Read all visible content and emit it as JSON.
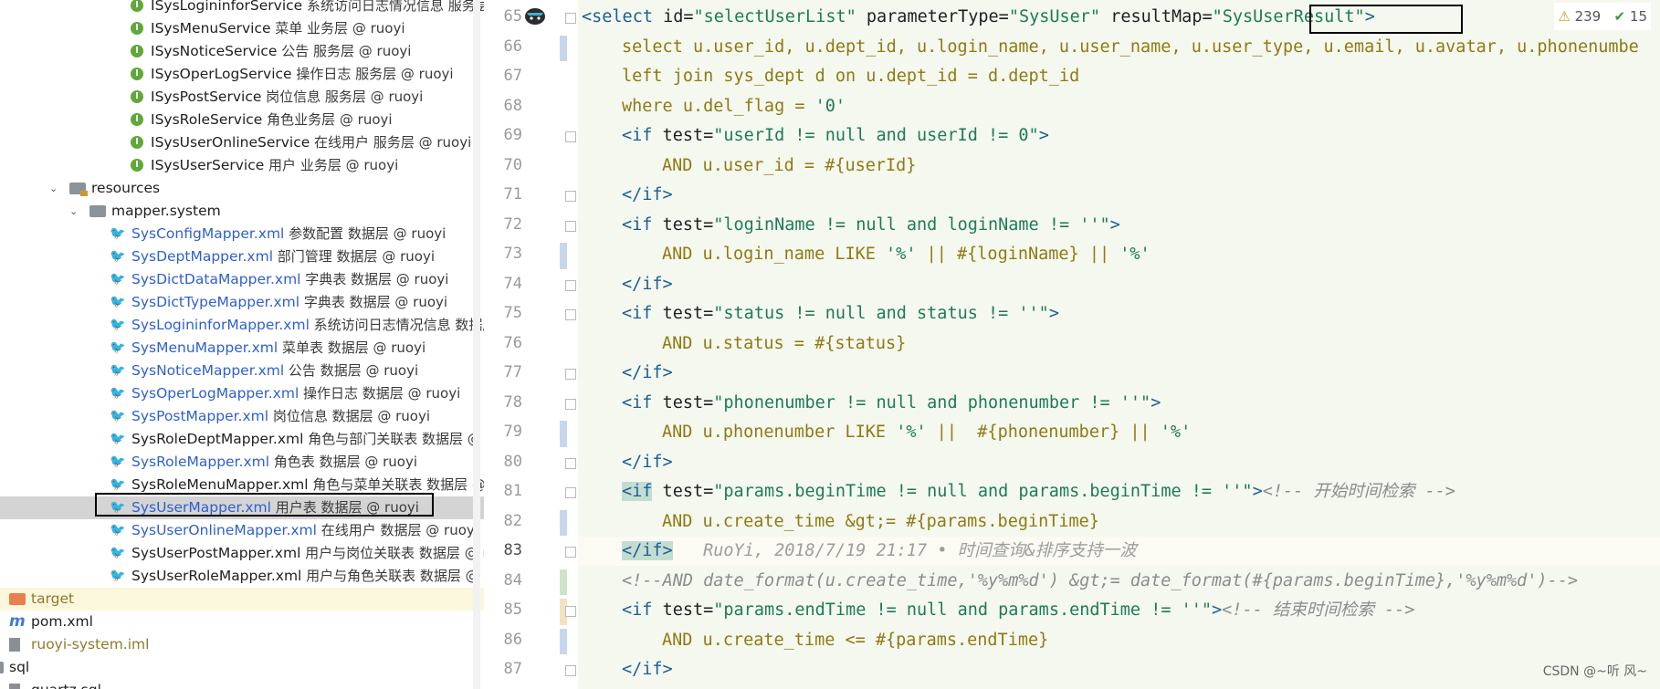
{
  "tree": {
    "items": [
      {
        "indent": 143,
        "icon": "interface",
        "name": "ISysLogininforService",
        "desc": "系统访问日志情况信息 服务层",
        "color": "dark"
      },
      {
        "indent": 143,
        "icon": "interface",
        "name": "ISysMenuService",
        "desc": "菜单 业务层 @ ruoyi",
        "color": "dark"
      },
      {
        "indent": 143,
        "icon": "interface",
        "name": "ISysNoticeService",
        "desc": "公告 服务层 @ ruoyi",
        "color": "dark"
      },
      {
        "indent": 143,
        "icon": "interface",
        "name": "ISysOperLogService",
        "desc": "操作日志 服务层 @ ruoyi",
        "color": "dark"
      },
      {
        "indent": 143,
        "icon": "interface",
        "name": "ISysPostService",
        "desc": "岗位信息 服务层 @ ruoyi",
        "color": "dark"
      },
      {
        "indent": 143,
        "icon": "interface",
        "name": "ISysRoleService",
        "desc": "角色业务层 @ ruoyi",
        "color": "dark"
      },
      {
        "indent": 143,
        "icon": "interface",
        "name": "ISysUserOnlineService",
        "desc": "在线用户 服务层 @ ruoyi",
        "color": "dark"
      },
      {
        "indent": 143,
        "icon": "interface",
        "name": "ISysUserService",
        "desc": "用户 业务层 @ ruoyi",
        "color": "dark"
      },
      {
        "indent": 76,
        "icon": "res-folder",
        "arrow": "⌄",
        "name": "resources",
        "desc": "",
        "color": "dark"
      },
      {
        "indent": 98,
        "icon": "folder",
        "arrow": "⌄",
        "name": "mapper.system",
        "desc": "",
        "color": "dark"
      },
      {
        "indent": 120,
        "icon": "xml",
        "name": "SysConfigMapper.xml",
        "desc": "参数配置 数据层 @ ruoyi",
        "color": "blue"
      },
      {
        "indent": 120,
        "icon": "xml",
        "name": "SysDeptMapper.xml",
        "desc": "部门管理 数据层 @ ruoyi",
        "color": "blue"
      },
      {
        "indent": 120,
        "icon": "xml",
        "name": "SysDictDataMapper.xml",
        "desc": "字典表 数据层 @ ruoyi",
        "color": "blue"
      },
      {
        "indent": 120,
        "icon": "xml",
        "name": "SysDictTypeMapper.xml",
        "desc": "字典表 数据层 @ ruoyi",
        "color": "blue"
      },
      {
        "indent": 120,
        "icon": "xml",
        "name": "SysLogininforMapper.xml",
        "desc": "系统访问日志情况信息 数据层",
        "color": "blue"
      },
      {
        "indent": 120,
        "icon": "xml",
        "name": "SysMenuMapper.xml",
        "desc": "菜单表 数据层 @ ruoyi",
        "color": "blue"
      },
      {
        "indent": 120,
        "icon": "xml",
        "name": "SysNoticeMapper.xml",
        "desc": "公告 数据层 @ ruoyi",
        "color": "blue"
      },
      {
        "indent": 120,
        "icon": "xml",
        "name": "SysOperLogMapper.xml",
        "desc": "操作日志 数据层 @ ruoyi",
        "color": "blue"
      },
      {
        "indent": 120,
        "icon": "xml",
        "name": "SysPostMapper.xml",
        "desc": "岗位信息 数据层 @ ruoyi",
        "color": "blue"
      },
      {
        "indent": 120,
        "icon": "xml",
        "name": "SysRoleDeptMapper.xml",
        "desc": "角色与部门关联表 数据层 @ ru",
        "color": "dark"
      },
      {
        "indent": 120,
        "icon": "xml",
        "name": "SysRoleMapper.xml",
        "desc": "角色表 数据层 @ ruoyi",
        "color": "blue"
      },
      {
        "indent": 120,
        "icon": "xml",
        "name": "SysRoleMenuMapper.xml",
        "desc": "角色与菜单关联表 数据层 @ r",
        "color": "dark"
      },
      {
        "indent": 120,
        "icon": "xml",
        "name": "SysUserMapper.xml",
        "desc": "用户表 数据层 @ ruoyi",
        "color": "blue",
        "selected": true
      },
      {
        "indent": 120,
        "icon": "xml",
        "name": "SysUserOnlineMapper.xml",
        "desc": "在线用户 数据层 @ ruoyi",
        "color": "blue"
      },
      {
        "indent": 120,
        "icon": "xml",
        "name": "SysUserPostMapper.xml",
        "desc": "用户与岗位关联表 数据层 @ ru",
        "color": "dark"
      },
      {
        "indent": 120,
        "icon": "xml",
        "name": "SysUserRoleMapper.xml",
        "desc": "用户与角色关联表 数据层 @ ru",
        "color": "dark"
      },
      {
        "indent": 10,
        "icon": "orange-folder",
        "arrow": "›",
        "name": "target",
        "desc": "",
        "color": "olive",
        "target": true
      },
      {
        "indent": 10,
        "icon": "maven",
        "name": "pom.xml",
        "desc": "",
        "color": "dark"
      },
      {
        "indent": 10,
        "icon": "file",
        "name": "ruoyi-system.iml",
        "desc": "",
        "color": "olive"
      },
      {
        "indent": -14,
        "icon": "folder",
        "name": "sql",
        "desc": "",
        "color": "dark"
      },
      {
        "indent": 10,
        "icon": "file",
        "name": "quartz.sql",
        "desc": "",
        "color": "dark"
      }
    ]
  },
  "inspection": {
    "warning_icon": "warning-triangle-icon",
    "warnings": "239",
    "check_icon": "checkmark-icon",
    "checks": "15"
  },
  "editor": {
    "current_line": 83,
    "lines": [
      {
        "n": 65,
        "indent": 1,
        "mark": "",
        "fold": true,
        "segs": [
          [
            "tag",
            "<select "
          ],
          [
            "an",
            "id="
          ],
          [
            "av",
            "\"selectUserList\""
          ],
          [
            "an",
            " parameterType="
          ],
          [
            "av",
            "\"SysUser\""
          ],
          [
            "an",
            " resultMap="
          ],
          [
            "av",
            "\"SysUserResult\""
          ],
          [
            "tag",
            ">"
          ]
        ]
      },
      {
        "n": 66,
        "indent": 2,
        "mark": "mod",
        "segs": [
          [
            "sql",
            "select u.user_id, u.dept_id, u.login_name, u.user_name, u.user_type, u.email, u.avatar, u.phonenumbe"
          ]
        ]
      },
      {
        "n": 67,
        "indent": 2,
        "mark": "",
        "segs": [
          [
            "sql",
            "left join sys_dept d on u.dept_id = d.dept_id"
          ]
        ]
      },
      {
        "n": 68,
        "indent": 2,
        "mark": "",
        "segs": [
          [
            "sql",
            "where u.del_flag = "
          ],
          [
            "str",
            "'0'"
          ]
        ]
      },
      {
        "n": 69,
        "indent": 2,
        "mark": "",
        "fold": true,
        "segs": [
          [
            "tag",
            "<if "
          ],
          [
            "an",
            "test="
          ],
          [
            "av",
            "\"userId != null and userId != 0\""
          ],
          [
            "tag",
            ">"
          ]
        ]
      },
      {
        "n": 70,
        "indent": 3,
        "mark": "",
        "segs": [
          [
            "sql",
            "AND u.user_id = #{userId}"
          ]
        ]
      },
      {
        "n": 71,
        "indent": 2,
        "mark": "",
        "fold": true,
        "segs": [
          [
            "tag",
            "</if>"
          ]
        ]
      },
      {
        "n": 72,
        "indent": 2,
        "mark": "",
        "fold": true,
        "segs": [
          [
            "tag",
            "<if "
          ],
          [
            "an",
            "test="
          ],
          [
            "av",
            "\"loginName != null and loginName != ''\""
          ],
          [
            "tag",
            ">"
          ]
        ]
      },
      {
        "n": 73,
        "indent": 3,
        "mark": "mod",
        "segs": [
          [
            "sql",
            "AND u.login_name LIKE "
          ],
          [
            "str",
            "'%'"
          ],
          [
            "sql",
            " || #{loginName} || "
          ],
          [
            "str",
            "'%'"
          ]
        ]
      },
      {
        "n": 74,
        "indent": 2,
        "mark": "",
        "fold": true,
        "segs": [
          [
            "tag",
            "</if>"
          ]
        ]
      },
      {
        "n": 75,
        "indent": 2,
        "mark": "",
        "fold": true,
        "segs": [
          [
            "tag",
            "<if "
          ],
          [
            "an",
            "test="
          ],
          [
            "av",
            "\"status != null and status != ''\""
          ],
          [
            "tag",
            ">"
          ]
        ]
      },
      {
        "n": 76,
        "indent": 3,
        "mark": "",
        "segs": [
          [
            "sql",
            "AND u.status = #{status}"
          ]
        ]
      },
      {
        "n": 77,
        "indent": 2,
        "mark": "",
        "fold": true,
        "segs": [
          [
            "tag",
            "</if>"
          ]
        ]
      },
      {
        "n": 78,
        "indent": 2,
        "mark": "",
        "fold": true,
        "segs": [
          [
            "tag",
            "<if "
          ],
          [
            "an",
            "test="
          ],
          [
            "av",
            "\"phonenumber != null and phonenumber != ''\""
          ],
          [
            "tag",
            ">"
          ]
        ]
      },
      {
        "n": 79,
        "indent": 3,
        "mark": "mod",
        "segs": [
          [
            "sql",
            "AND u.phonenumber LIKE "
          ],
          [
            "str",
            "'%'"
          ],
          [
            "sql",
            " ||  #{phonenumber} || "
          ],
          [
            "str",
            "'%'"
          ]
        ]
      },
      {
        "n": 80,
        "indent": 2,
        "mark": "",
        "fold": true,
        "segs": [
          [
            "tag",
            "</if>"
          ]
        ]
      },
      {
        "n": 81,
        "indent": 2,
        "mark": "",
        "fold": true,
        "segs": [
          [
            "hltag",
            "<if"
          ],
          [
            "an",
            " test="
          ],
          [
            "av",
            "\"params.beginTime != null and params.beginTime != ''\""
          ],
          [
            "tag",
            ">"
          ],
          [
            "cmt",
            "<!-- 开始时间检索 -->"
          ]
        ]
      },
      {
        "n": 82,
        "indent": 3,
        "mark": "mod",
        "segs": [
          [
            "sql",
            "AND u.create_time &gt;= #{params.beginTime}"
          ]
        ]
      },
      {
        "n": 83,
        "indent": 2,
        "mark": "",
        "fold": true,
        "segs": [
          [
            "hltag",
            "</if>"
          ],
          [
            "blame",
            "   RuoYi, 2018/7/19 21:17 • 时间查询&排序支持一波"
          ]
        ]
      },
      {
        "n": 84,
        "indent": 2,
        "mark": "add",
        "segs": [
          [
            "cmt",
            "<!--AND date_format(u.create_time,'%y%m%d') &gt;= date_format(#{params.beginTime},'%y%m%d')-->"
          ]
        ]
      },
      {
        "n": 85,
        "indent": 2,
        "mark": "chg",
        "fold": true,
        "segs": [
          [
            "tag",
            "<if "
          ],
          [
            "an",
            "test="
          ],
          [
            "av",
            "\"params.endTime != null and params.endTime != ''\""
          ],
          [
            "tag",
            ">"
          ],
          [
            "cmt",
            "<!-- 结束时间检索 -->"
          ]
        ]
      },
      {
        "n": 86,
        "indent": 3,
        "mark": "mod",
        "segs": [
          [
            "sql",
            "AND u.create_time <= #{params.endTime}"
          ]
        ]
      },
      {
        "n": 87,
        "indent": 2,
        "mark": "",
        "fold": true,
        "segs": [
          [
            "tag",
            "</if>"
          ]
        ]
      }
    ]
  },
  "watermark": "CSDN @~听 风~"
}
